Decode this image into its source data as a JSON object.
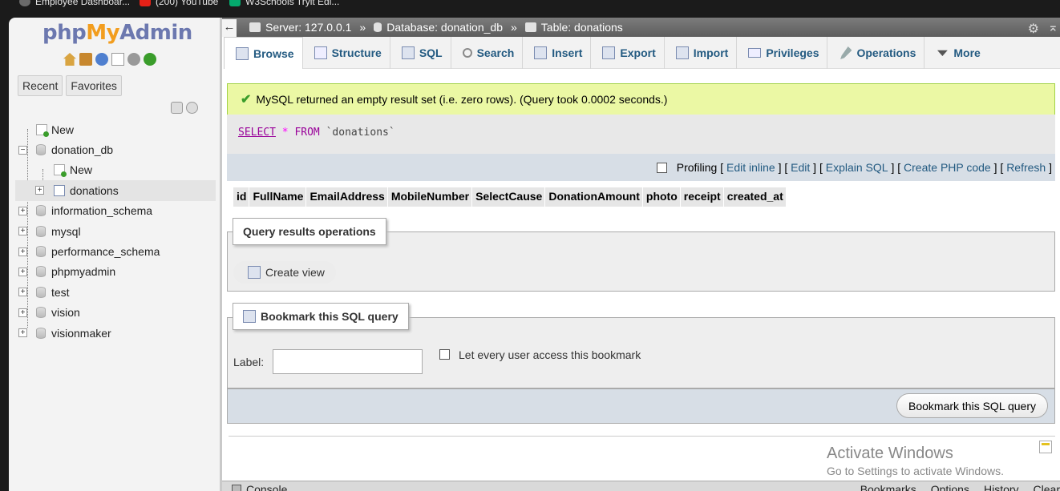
{
  "browser": {
    "bookmarks": [
      {
        "label": "Employee Dashboar...",
        "icon": "globe-icon"
      },
      {
        "label": "(200) YouTube",
        "icon": "youtube-icon"
      },
      {
        "label": "W3Schools Tryit Edi...",
        "icon": "w3schools-icon"
      }
    ]
  },
  "nav": {
    "logo": {
      "php": "php",
      "my": "My",
      "admin": "Admin"
    },
    "quick_icons": [
      "home-icon",
      "exit-icon",
      "help-icon",
      "docs-icon",
      "settings-icon",
      "reload-icon"
    ],
    "tabs": {
      "recent": "Recent",
      "favorites": "Favorites"
    },
    "tree": [
      {
        "label": "New",
        "type": "new",
        "level": 0
      },
      {
        "label": "donation_db",
        "type": "db",
        "level": 0,
        "expanded": true
      },
      {
        "label": "New",
        "type": "new",
        "level": 1
      },
      {
        "label": "donations",
        "type": "table",
        "level": 1,
        "selected": true
      },
      {
        "label": "information_schema",
        "type": "db",
        "level": 0
      },
      {
        "label": "mysql",
        "type": "db",
        "level": 0
      },
      {
        "label": "performance_schema",
        "type": "db",
        "level": 0
      },
      {
        "label": "phpmyadmin",
        "type": "db",
        "level": 0
      },
      {
        "label": "test",
        "type": "db",
        "level": 0
      },
      {
        "label": "vision",
        "type": "db",
        "level": 0
      },
      {
        "label": "visionmaker",
        "type": "db",
        "level": 0
      }
    ]
  },
  "breadcrumb": {
    "back": "←",
    "server": "Server: 127.0.0.1",
    "database": "Database: donation_db",
    "table": "Table: donations",
    "separator": "»"
  },
  "tabs": [
    {
      "label": "Browse",
      "icon": "browse-icon",
      "active": true
    },
    {
      "label": "Structure",
      "icon": "structure-icon"
    },
    {
      "label": "SQL",
      "icon": "sql-icon"
    },
    {
      "label": "Search",
      "icon": "search-icon"
    },
    {
      "label": "Insert",
      "icon": "insert-icon"
    },
    {
      "label": "Export",
      "icon": "export-icon"
    },
    {
      "label": "Import",
      "icon": "import-icon"
    },
    {
      "label": "Privileges",
      "icon": "privileges-icon"
    },
    {
      "label": "Operations",
      "icon": "operations-icon"
    },
    {
      "label": "More",
      "icon": "chevron-down-icon"
    }
  ],
  "message": {
    "text": "MySQL returned an empty result set (i.e. zero rows). (Query took 0.0002 seconds.)"
  },
  "query": {
    "select": "SELECT",
    "star": "*",
    "from": "FROM",
    "table": "`donations`"
  },
  "query_links": {
    "profiling": "Profiling",
    "edit_inline": "Edit inline",
    "edit": "Edit",
    "explain": "Explain SQL",
    "create_php": "Create PHP code",
    "refresh": "Refresh"
  },
  "columns": [
    "id",
    "FullName",
    "EmailAddress",
    "MobileNumber",
    "SelectCause",
    "DonationAmount",
    "photo",
    "receipt",
    "created_at"
  ],
  "query_results_ops": {
    "title": "Query results operations",
    "create_view": "Create view"
  },
  "bookmark": {
    "title": "Bookmark this SQL query",
    "label": "Label:",
    "label_value": "",
    "share": "Let every user access this bookmark",
    "button": "Bookmark this SQL query"
  },
  "watermark": {
    "line1": "Activate Windows",
    "line2": "Go to Settings to activate Windows."
  },
  "console": {
    "label": "Console",
    "right": [
      "Bookmarks",
      "Options",
      "History",
      "Clear"
    ]
  },
  "colors": {
    "accent": "#235a81",
    "success_bg": "#ebf8a4",
    "success_border": "#a2d246"
  }
}
